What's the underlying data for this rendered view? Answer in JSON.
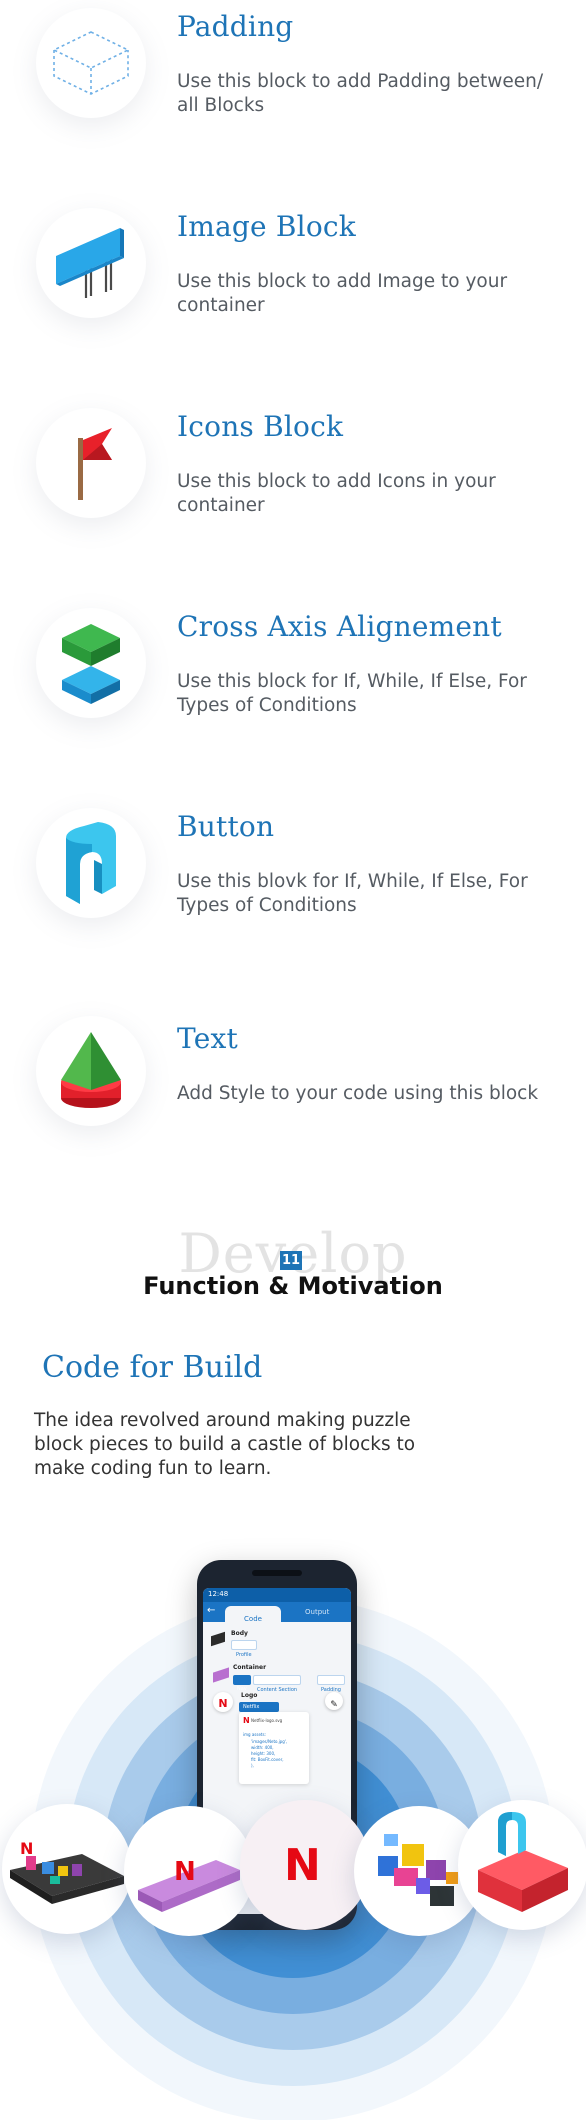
{
  "blocks": [
    {
      "title": "Padding",
      "description": "Use this block to add Padding between/ all Blocks",
      "icon": "padding-cube-icon"
    },
    {
      "title": "Image Block",
      "description": "Use this block to add Image to your container",
      "icon": "billboard-icon"
    },
    {
      "title": "Icons Block",
      "description": "Use this block to add Icons in your container",
      "icon": "flag-icon"
    },
    {
      "title": "Cross Axis Alignement",
      "description": "Use this block for If, While, If Else, For Types of Conditions",
      "icon": "stacked-blocks-icon"
    },
    {
      "title": "Button",
      "description": "Use this blovk for If, While, If Else, For Types of Conditions",
      "icon": "arch-block-icon"
    },
    {
      "title": "Text",
      "description": "Add Style to your code using this block",
      "icon": "cone-block-icon"
    }
  ],
  "section": {
    "background_word": "Develop",
    "number": "11",
    "title": "Function & Motivation"
  },
  "code_build": {
    "title": "Code for Build",
    "description": "The idea revolved around making puzzle block pieces to build a castle of blocks to make coding fun to learn."
  },
  "phone": {
    "time": "12:48",
    "tab_code": "Code",
    "tab_output": "Output",
    "node_body": "Body",
    "chip_profile": "Profile",
    "node_container": "Container",
    "chip_nav": "Nav",
    "chip_content": "Content Section",
    "chip_padding": "Padding",
    "node_logo": "Logo",
    "logo_tag": "Netflix",
    "logo_file": "Netflix-logo.svg",
    "img_lines": [
      "img assets:",
      "'images/Neto.jpg',",
      "width: 400,",
      "height: 300,",
      "fit: BoxFit.cover,",
      "),"
    ]
  },
  "colors": {
    "accent": "#1e74b6",
    "ring_outer": "#eaf2fa",
    "ring_mid": "#b8d4ee",
    "ring_inner": "#4c95d6"
  }
}
